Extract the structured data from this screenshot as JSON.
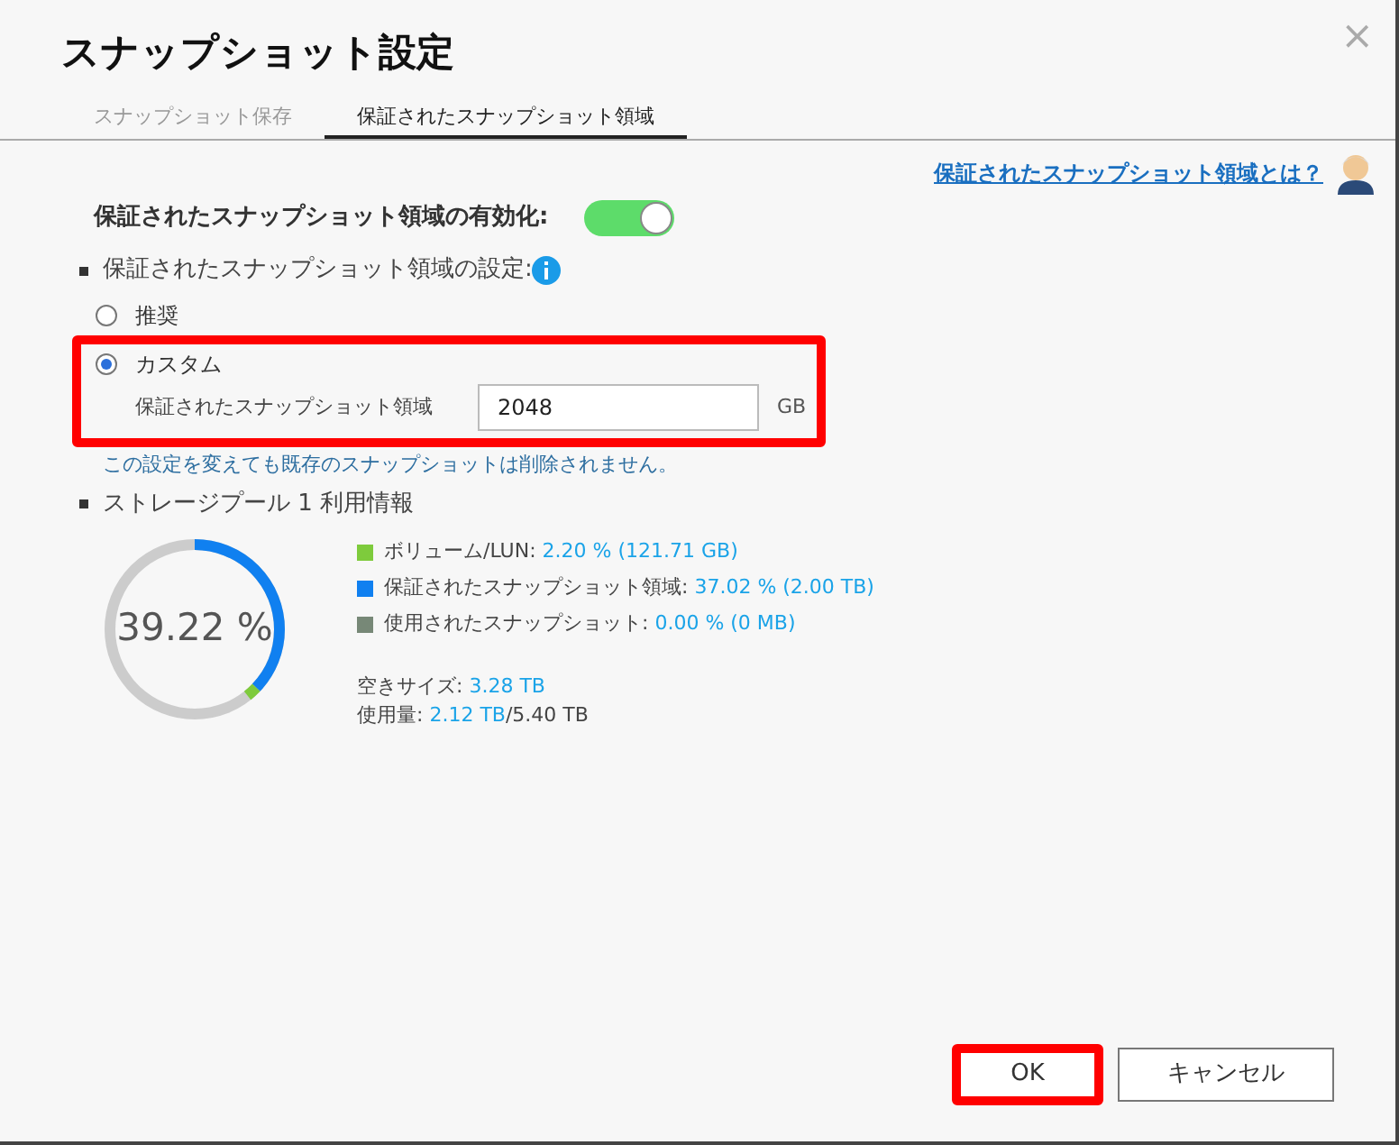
{
  "dialog": {
    "title": "スナップショット設定",
    "close": "×"
  },
  "tabs": [
    {
      "label": "スナップショット保存",
      "selected": false
    },
    {
      "label": "保証されたスナップショット領域",
      "selected": true
    }
  ],
  "help_link": "保証されたスナップショット領域とは？",
  "enable": {
    "label": "保証されたスナップショット領域の有効化:",
    "on": true
  },
  "settings": {
    "heading": "保証されたスナップショット領域の設定:",
    "options": [
      {
        "label": "推奨",
        "selected": false,
        "highlighted": false
      },
      {
        "label": "カスタム",
        "selected": true,
        "highlighted": true,
        "field_label": "保証されたスナップショット領域",
        "value": "2048",
        "unit": "GB"
      }
    ],
    "note": "この設定を変えても既存のスナップショットは削除されません。"
  },
  "usage": {
    "heading": "ストレージプール 1 利用情報",
    "center": "39.22 %",
    "legend": [
      {
        "label": "ボリューム/LUN:",
        "value": "2.20 % (121.71 GB)",
        "color": "#7ecb3c",
        "level": 0.022
      },
      {
        "label": "保証されたスナップショット領域:",
        "value": "37.02 % (2.00 TB)",
        "color": "#1080f0",
        "level": 0.3702
      },
      {
        "label": "使用されたスナップショット:",
        "value": "0.00 % (0 MB)",
        "color": "#778877",
        "level": 0
      }
    ],
    "free_label": "空きサイズ:",
    "free": "3.28 TB",
    "used_label": "使用量:",
    "used": "2.12 TB",
    "total": "/5.40 TB"
  },
  "buttons": [
    {
      "label": "OK",
      "kind": "primary",
      "highlighted": true
    },
    {
      "label": "キャンセル",
      "kind": "secondary",
      "highlighted": false
    }
  ]
}
